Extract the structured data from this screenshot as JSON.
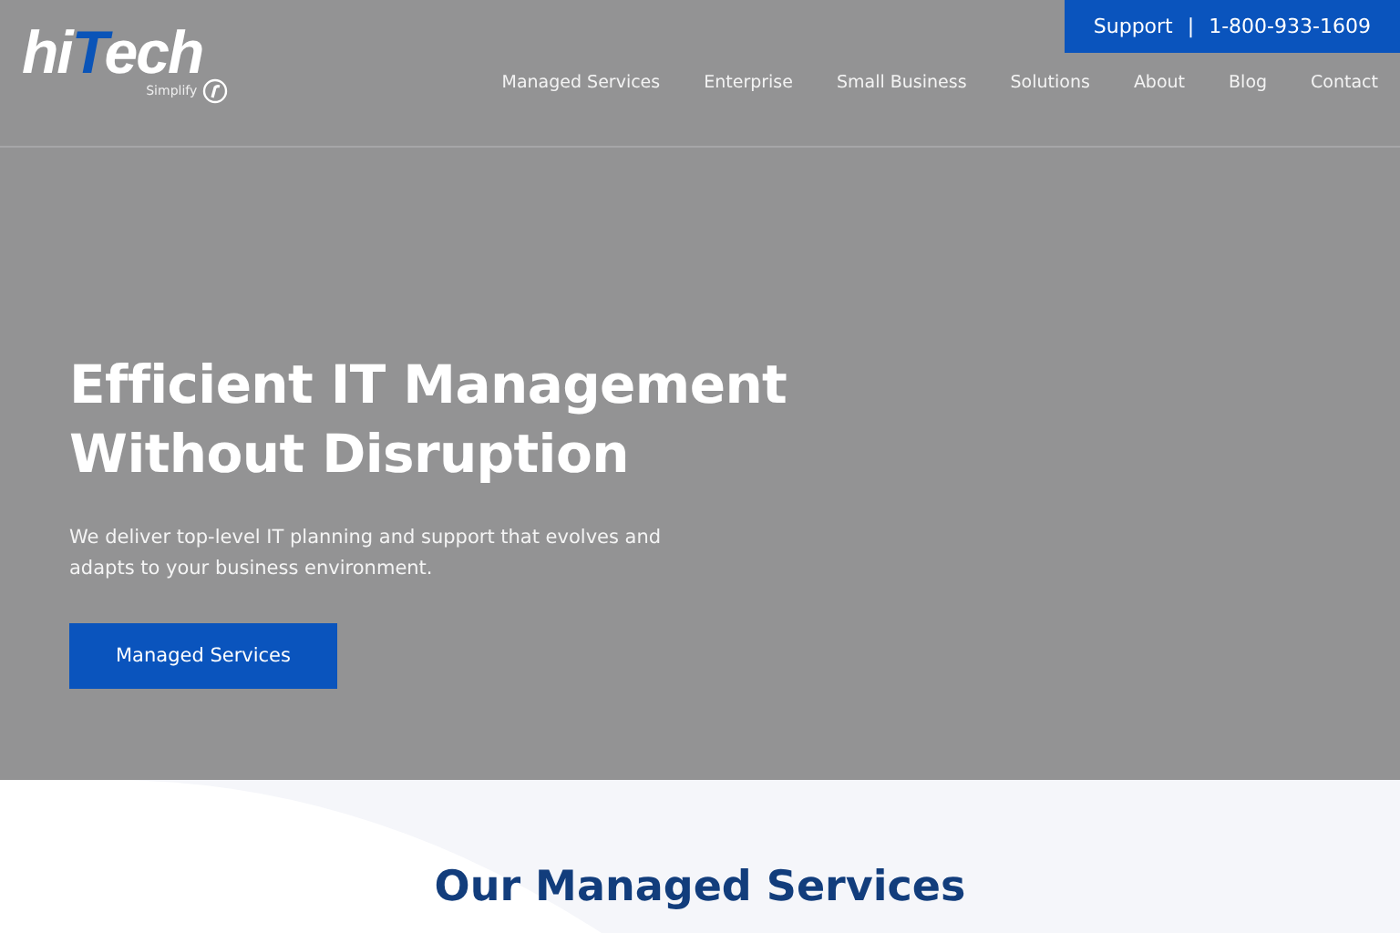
{
  "logo": {
    "text_start": "hi",
    "text_accent": "T",
    "text_end": "ech",
    "tagline": "Simplify"
  },
  "support": {
    "label": "Support",
    "separator": "|",
    "phone": "1-800-933-1609"
  },
  "nav": [
    {
      "label": "Managed Services"
    },
    {
      "label": "Enterprise"
    },
    {
      "label": "Small Business"
    },
    {
      "label": "Solutions"
    },
    {
      "label": "About"
    },
    {
      "label": "Blog"
    },
    {
      "label": "Contact"
    }
  ],
  "hero": {
    "title_line_1": "Efficient IT Management",
    "title_line_2": "Without Disruption",
    "text": "We deliver top-level IT planning and support that evolves and adapts to your business environment.",
    "button": "Managed Services"
  },
  "section": {
    "title": "Our Managed Services"
  }
}
